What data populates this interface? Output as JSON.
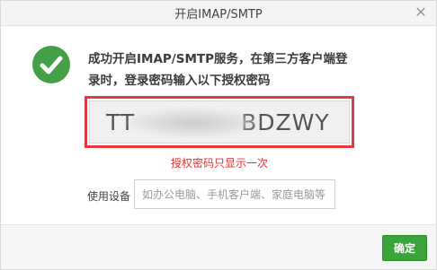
{
  "window": {
    "title": "开启IMAP/SMTP",
    "close_icon": "close-icon"
  },
  "message": {
    "line1": "成功开启IMAP/SMTP服务，在第三方客户端登",
    "line2": "录时，登录密码输入以下授权密码",
    "icon": "success-check-icon"
  },
  "auth_code": {
    "prefix": "TT",
    "suffix": "BDZWY",
    "accent_color": "#e03b41"
  },
  "warning": "授权密码只显示一次",
  "device": {
    "label": "使用设备",
    "placeholder": "如办公电脑、手机客户端、家庭电脑等",
    "value": ""
  },
  "footer": {
    "confirm_label": "确定",
    "confirm_color": "#3aa33a"
  }
}
